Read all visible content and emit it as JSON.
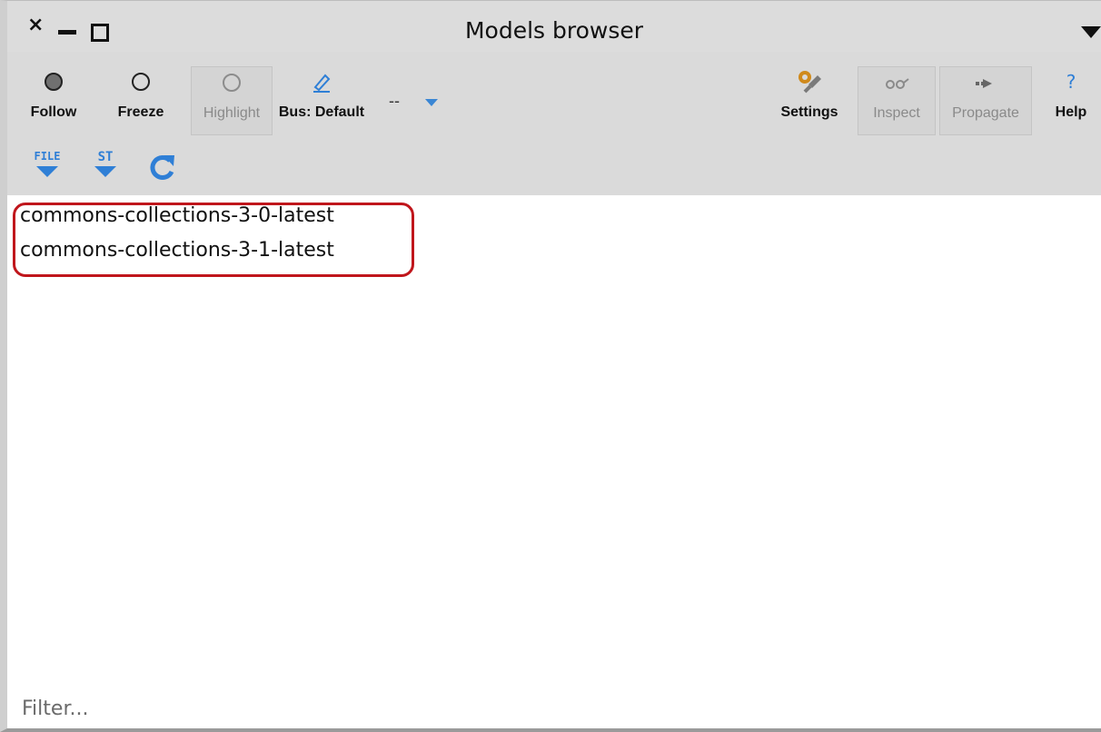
{
  "window": {
    "title": "Models browser",
    "controls": {
      "close": "×"
    }
  },
  "toolbar": {
    "follow_label": "Follow",
    "freeze_label": "Freeze",
    "highlight_label": "Highlight",
    "bus_label": "Bus: Default",
    "bus_extra": "--",
    "settings_label": "Settings",
    "inspect_label": "Inspect",
    "propagate_label": "Propagate",
    "help_label": "Help",
    "help_glyph": "?"
  },
  "subtoolbar": {
    "file_label": "FILE",
    "st_label": "ST"
  },
  "models": [
    "commons-collections-3-0-latest",
    "commons-collections-3-1-latest"
  ],
  "filter": {
    "placeholder": "Filter..."
  },
  "colors": {
    "accent_blue": "#2f7fd6",
    "highlight_red": "#c0161c",
    "settings_orange": "#d08a1c"
  }
}
